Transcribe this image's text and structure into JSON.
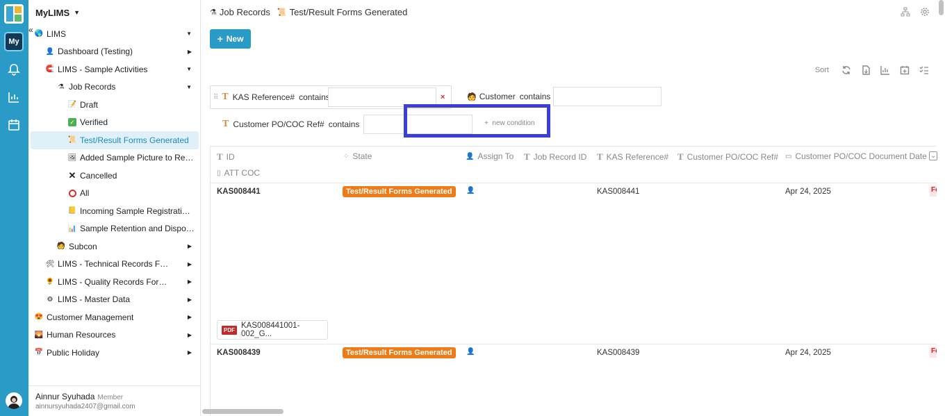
{
  "app": {
    "name": "MyLIMS",
    "my_label": "My"
  },
  "sidebar": {
    "items": [
      {
        "label": "LIMS",
        "icon": "globe-icon",
        "arrow": "down"
      },
      {
        "label": "Dashboard (Testing)",
        "icon": "person-icon",
        "arrow": "right"
      },
      {
        "label": "LIMS - Sample Activities",
        "icon": "magnet-icon",
        "arrow": "down"
      },
      {
        "label": "Job Records",
        "icon": "flask-icon",
        "arrow": "down"
      },
      {
        "label": "Draft",
        "icon": "memo-icon"
      },
      {
        "label": "Verified",
        "icon": "check-icon"
      },
      {
        "label": "Test/Result Forms Generated",
        "icon": "scroll-icon",
        "active": true
      },
      {
        "label": "Added Sample Picture to Repor...",
        "icon": "picture-icon"
      },
      {
        "label": "Cancelled",
        "icon": "x-icon"
      },
      {
        "label": "All",
        "icon": "circle-icon"
      },
      {
        "label": "Incoming Sample Registration ...",
        "icon": "ledger-icon"
      },
      {
        "label": "Sample Retention and Disposal...",
        "icon": "chart-icon"
      },
      {
        "label": "Subcon",
        "icon": "stamp-icon",
        "arrow": "right"
      },
      {
        "label": "LIMS - Technical Records Form (T...",
        "icon": "tools-icon",
        "arrow": "right"
      },
      {
        "label": "LIMS - Quality Records Form (QRF)",
        "icon": "sunflower-icon",
        "arrow": "right"
      },
      {
        "label": "LIMS - Master Data",
        "icon": "gear-icon",
        "arrow": "right"
      },
      {
        "label": "Customer Management",
        "icon": "smiley-icon",
        "arrow": "right"
      },
      {
        "label": "Human Resources",
        "icon": "sunset-icon",
        "arrow": "right"
      },
      {
        "label": "Public Holiday",
        "icon": "calendar-icon",
        "arrow": "right"
      }
    ],
    "user": {
      "name": "Ainnur Syuhada",
      "role": "Member",
      "email": "ainnursyuhada2407@gmail.com"
    }
  },
  "breadcrumb": {
    "first": "Job Records",
    "second": "Test/Result Forms Generated"
  },
  "toolbar": {
    "new_label": "New",
    "sort_label": "Sort"
  },
  "filters": {
    "kas_label": "KAS Reference#",
    "kas_op": "contains",
    "kas_value": "",
    "customer_label": "Customer",
    "customer_op": "contains",
    "customer_value": "",
    "po_label": "Customer PO/COC Ref#",
    "po_op": "contains",
    "po_value": "",
    "new_condition": "new condition"
  },
  "columns": [
    "ID",
    "State",
    "Assign To",
    "Job Record ID",
    "KAS Reference#",
    "Customer PO/COC Ref#",
    "Customer PO/COC Document Date",
    "ATT COC"
  ],
  "rows": [
    {
      "id": "KAS008441",
      "state": "Test/Result Forms Generated",
      "kas_ref": "KAS008441",
      "date": "Apr 24, 2025",
      "attachment": "KAS008441001-002_G...",
      "attachment_type": "PDF",
      "overflow": "Fo"
    },
    {
      "id": "KAS008439",
      "state": "Test/Result Forms Generated",
      "kas_ref": "KAS008439",
      "date": "Apr 24, 2025",
      "overflow": "Fo"
    }
  ],
  "colors": {
    "accent": "#2a9bc6",
    "badge": "#f07b16",
    "highlight": "#3a3fd8"
  }
}
